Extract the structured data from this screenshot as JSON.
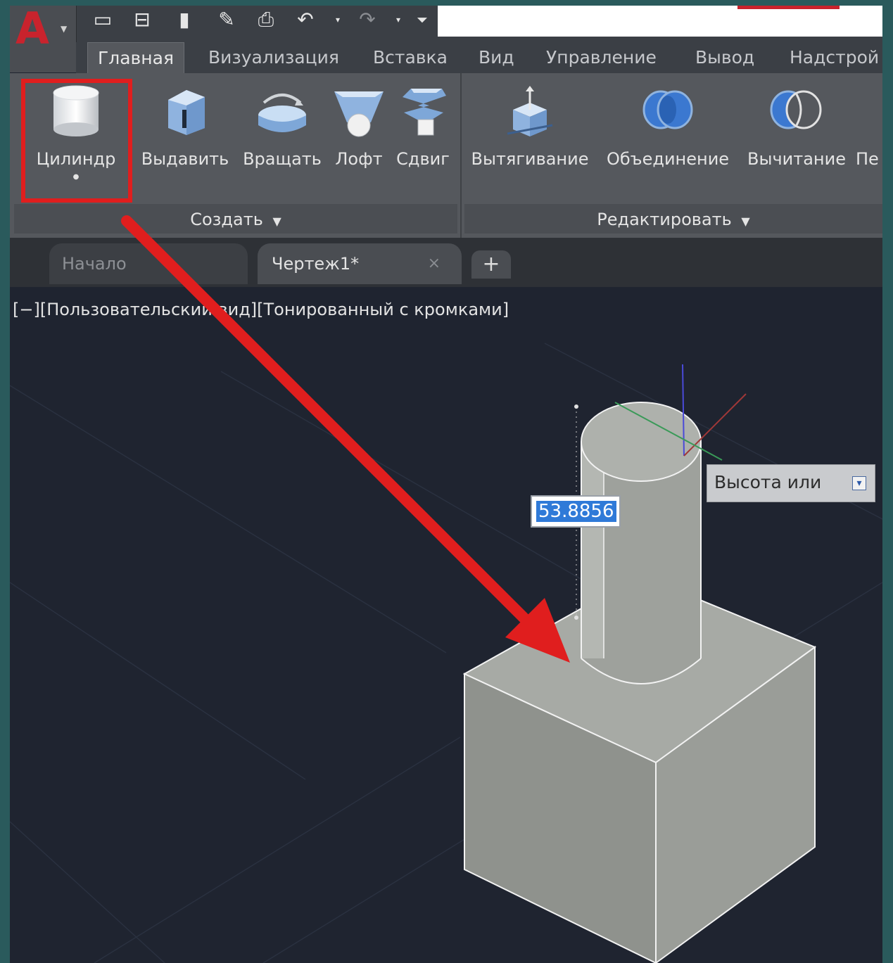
{
  "app": {
    "logo_letter": "A"
  },
  "quick_access": {
    "icons": [
      "new-icon",
      "open-icon",
      "save-icon",
      "save-as-icon",
      "print-icon",
      "undo-icon",
      "redo-icon",
      "customize-icon"
    ]
  },
  "ribbon_tabs": [
    "Главная",
    "Визуализация",
    "Вставка",
    "Вид",
    "Управление",
    "Вывод",
    "Надстрой"
  ],
  "create_panel": {
    "title": "Создать",
    "tools": [
      {
        "label": "Цилиндр",
        "icon": "cylinder-icon"
      },
      {
        "label": "Выдавить",
        "icon": "extrude-icon"
      },
      {
        "label": "Вращать",
        "icon": "revolve-icon"
      },
      {
        "label": "Лофт",
        "icon": "loft-icon"
      },
      {
        "label": "Сдвиг",
        "icon": "sweep-icon"
      }
    ]
  },
  "edit_panel": {
    "title": "Редактировать",
    "tools": [
      {
        "label": "Вытягивание",
        "icon": "presspull-icon"
      },
      {
        "label": "Объединение",
        "icon": "union-icon"
      },
      {
        "label": "Вычитание",
        "icon": "subtract-icon"
      },
      {
        "label": "Пе",
        "icon": "intersect-icon"
      }
    ]
  },
  "file_tabs": {
    "start": "Начало",
    "drawing": "Чертеж1*",
    "close": "×",
    "add": "+"
  },
  "viewport": {
    "label": "[−][Пользовательский вид][Тонированный с кромками]",
    "dynamic_input_value": "53.8856",
    "prompt": "Высота или"
  },
  "colors": {
    "highlight": "#e01e1e",
    "accent_blue": "#2f7ad8",
    "brand_red": "#c9232d"
  }
}
